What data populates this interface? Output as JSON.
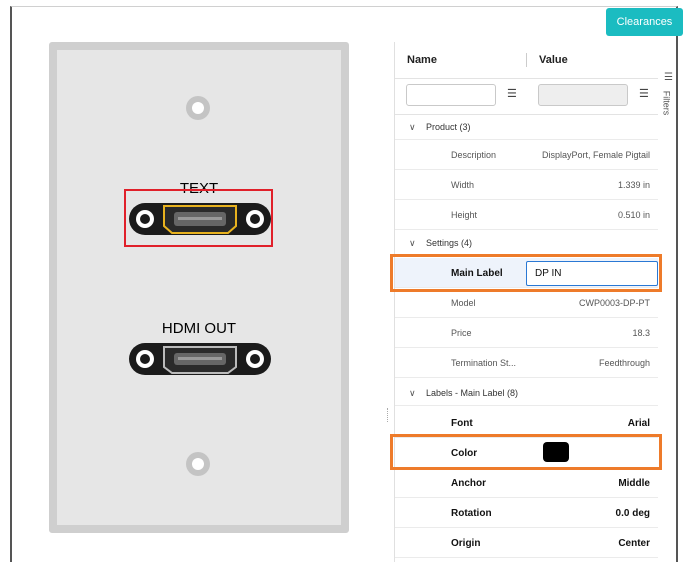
{
  "toolbar": {
    "clearances_label": "Clearances"
  },
  "canvas": {
    "ports": [
      {
        "label": "TEXT"
      },
      {
        "label": "HDMI OUT"
      }
    ]
  },
  "grid": {
    "headers": {
      "name": "Name",
      "value": "Value"
    },
    "groups": [
      {
        "title": "Product (3)"
      },
      {
        "title": "Settings (4)"
      },
      {
        "title": "Labels - Main Label (8)"
      }
    ],
    "product_rows": [
      {
        "name": "Description",
        "value": "DisplayPort, Female Pigtail"
      },
      {
        "name": "Width",
        "value": "1.339 in"
      },
      {
        "name": "Height",
        "value": "0.510 in"
      }
    ],
    "settings_rows": [
      {
        "name": "Main Label",
        "value": "DP IN"
      },
      {
        "name": "Model",
        "value": "CWP0003-DP-PT"
      },
      {
        "name": "Price",
        "value": "18.3"
      },
      {
        "name": "Termination St...",
        "value": "Feedthrough"
      }
    ],
    "label_rows": [
      {
        "name": "Font",
        "value": "Arial"
      },
      {
        "name": "Color",
        "value": ""
      },
      {
        "name": "Anchor",
        "value": "Middle"
      },
      {
        "name": "Rotation",
        "value": "0.0 deg"
      },
      {
        "name": "Origin",
        "value": "Center"
      }
    ],
    "color_value": "#000000"
  },
  "side_tab": {
    "label": "Filters"
  },
  "colors": {
    "accent": "#1bbcc1",
    "highlight": "#ee7b2a",
    "selection": "#e0202a"
  }
}
